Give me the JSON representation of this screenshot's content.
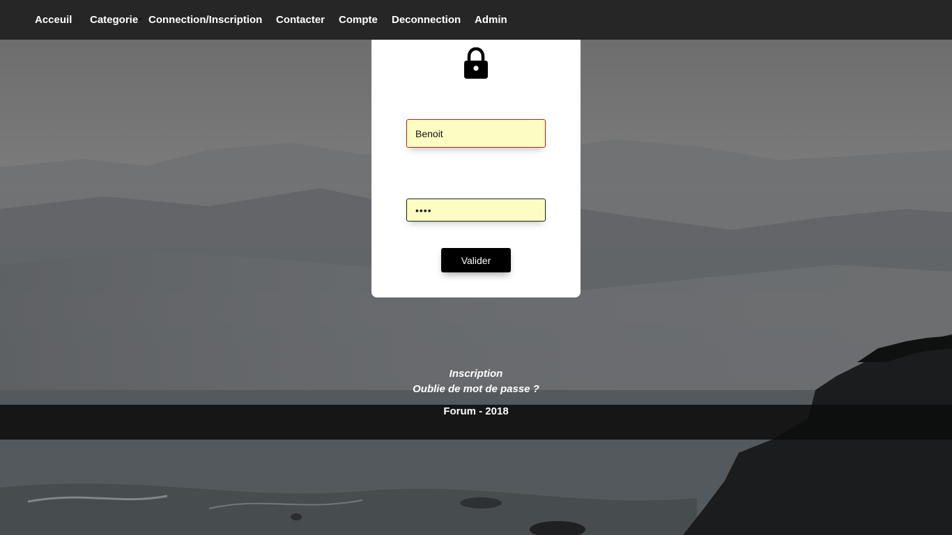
{
  "nav": {
    "home": "Acceuil",
    "category": "Categorie",
    "login": "Connection/Inscription",
    "contact": "Contacter",
    "account": "Compte",
    "logout": "Deconnection",
    "admin": "Admin"
  },
  "form": {
    "username_value": "Benoit",
    "password_value": "••••",
    "submit_label": "Valider"
  },
  "links": {
    "register": "Inscription",
    "forgot_password": "Oublie de mot de passe ?"
  },
  "footer": {
    "text": "Forum - 2018"
  },
  "icons": {
    "lock": "lock-icon",
    "caret": "caret-down-icon"
  },
  "colors": {
    "navbar": "#262626",
    "input_background": "#fcfdc2",
    "input_error_border": "#c0201a",
    "button": "#000000"
  }
}
